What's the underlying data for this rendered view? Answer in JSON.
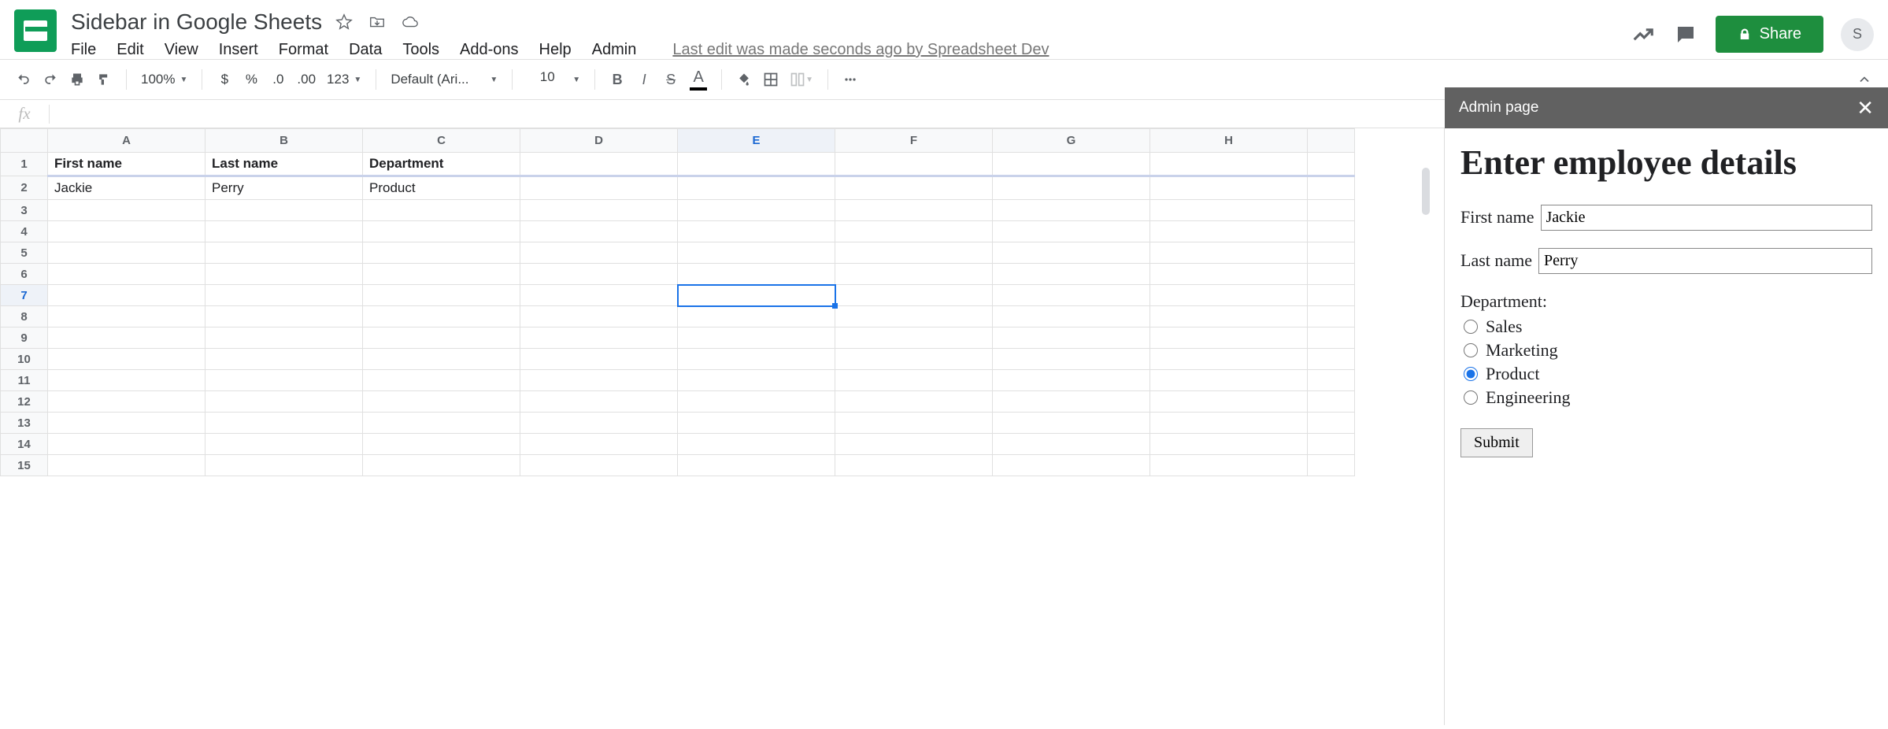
{
  "doc": {
    "title": "Sidebar in Google Sheets"
  },
  "menubar": {
    "items": [
      "File",
      "Edit",
      "View",
      "Insert",
      "Format",
      "Data",
      "Tools",
      "Add-ons",
      "Help",
      "Admin"
    ],
    "last_edit": "Last edit was made seconds ago by Spreadsheet Dev"
  },
  "header": {
    "share_label": "Share",
    "avatar_letter": "S"
  },
  "toolbar": {
    "zoom": "100%",
    "font_name": "Default (Ari...",
    "font_size": "10",
    "num_fmt": "123",
    "dollar": "$",
    "percent": "%",
    "dec_less": ".0",
    "dec_more": ".00",
    "bold": "B",
    "italic": "I",
    "strike": "S",
    "text_color": "A"
  },
  "grid": {
    "columns": [
      "A",
      "B",
      "C",
      "D",
      "E",
      "F",
      "G",
      "H"
    ],
    "rows_shown": 15,
    "selected_cell": "E7",
    "data": [
      [
        "First name",
        "Last name",
        "Department",
        "",
        "",
        "",
        "",
        ""
      ],
      [
        "Jackie",
        "Perry",
        "Product",
        "",
        "",
        "",
        "",
        ""
      ]
    ]
  },
  "sidebar": {
    "header": "Admin page",
    "title": "Enter employee details",
    "first_name_label": "First name",
    "first_name_value": "Jackie",
    "last_name_label": "Last name",
    "last_name_value": "Perry",
    "department_label": "Department:",
    "departments": [
      "Sales",
      "Marketing",
      "Product",
      "Engineering"
    ],
    "department_selected": "Product",
    "submit_label": "Submit"
  }
}
